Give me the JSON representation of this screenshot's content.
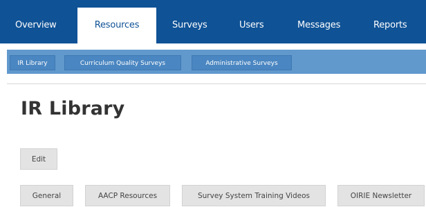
{
  "top_nav": {
    "tabs": [
      {
        "label": "Overview"
      },
      {
        "label": "Resources"
      },
      {
        "label": "Surveys"
      },
      {
        "label": "Users"
      },
      {
        "label": "Messages"
      },
      {
        "label": "Reports"
      }
    ],
    "active_tab": "Resources",
    "background_color": "#0f5296"
  },
  "sub_nav": {
    "items": [
      {
        "label": "IR Library"
      },
      {
        "label": "Curriculum Quality Surveys"
      },
      {
        "label": "Administrative Surveys"
      }
    ]
  },
  "main": {
    "title": "IR Library",
    "edit_label": "Edit",
    "category_tabs": [
      {
        "label": "General"
      },
      {
        "label": "AACP Resources"
      },
      {
        "label": "Survey System Training Videos"
      },
      {
        "label": "OIRIE Newsletter"
      }
    ]
  }
}
